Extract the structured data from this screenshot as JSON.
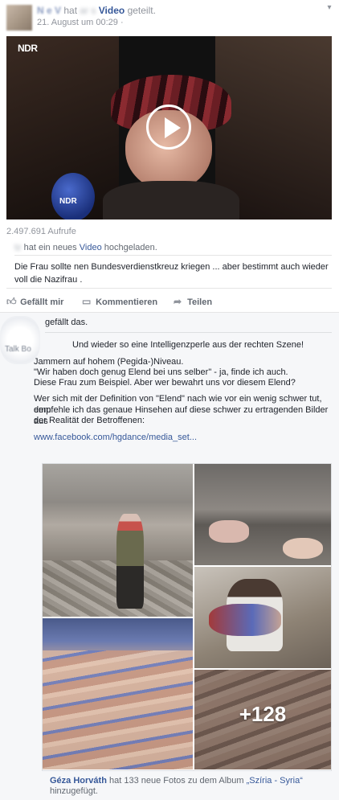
{
  "header": {
    "name": "N    e  V",
    "hat": "hat",
    "blurred": "      ar      s",
    "video_label": "Video",
    "geteilt": "geteilt.",
    "time": "21. August um 00:29 ·",
    "time_blur": "     ",
    "menu_icon": "chevron-down-icon"
  },
  "video": {
    "logo": "NDR",
    "mic_logo": "NDR",
    "play_icon": "play-icon"
  },
  "views": "2.497.691 Aufrufe",
  "shared": {
    "page_blur": "       tz",
    "uploaded_prefix": "hat ein neues",
    "video_link": "Video",
    "uploaded_suffix": "hochgeladen.",
    "text": "Die Frau sollte nen Bundesverdienstkreuz kriegen ... aber bestimmt auch wieder voll die Nazifrau ."
  },
  "actions": {
    "like": "Gefällt mir",
    "comment": "Kommentieren",
    "share": "Teilen"
  },
  "likes_line": {
    "blur": "       ",
    "text": "gefällt das."
  },
  "comment": {
    "commenter_fragment": "Talk Bo",
    "lines": [
      "Und wieder so eine Intelligenzperle aus der rechten Szene!",
      "Jammern auf hohem (Pegida-)Niveau.",
      "\"Wir haben doch genug Elend bei uns selber\" - ja, finde ich auch.",
      "Diese Frau zum Beispiel. Aber wer bewahrt uns vor diesem Elend?",
      "Wer sich mit der Definition von \"Elend\" nach wie vor ein wenig schwer tut, dem",
      "empfehle ich das genaue Hinsehen auf diese schwer zu ertragenden Bilder aus",
      "der Realität der Betroffenen:"
    ],
    "link": "www.facebook.com/hgdance/media_set..."
  },
  "album": {
    "more_count": "+128",
    "caption_name": "Géza Horváth",
    "caption_middle": "hat 133 neue Fotos zu dem Album",
    "caption_album": "„Szíria - Syria“",
    "caption_suffix": "hinzugefügt."
  }
}
